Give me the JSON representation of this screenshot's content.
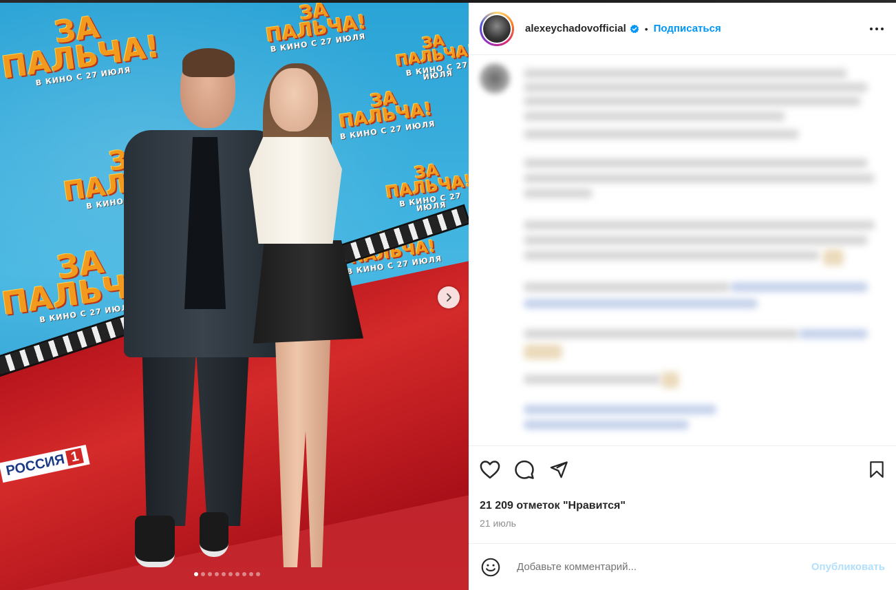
{
  "post": {
    "username": "alexeychadovofficial",
    "separator": "•",
    "follow_label": "Подписаться",
    "likes_text": "21 209 отметок \"Нравится\"",
    "date_text": "21 июль",
    "comment_placeholder": "Добавьте комментарий...",
    "publish_label": "Опубликовать"
  },
  "media": {
    "poster_title_line1": "ЗА",
    "poster_title_line2": "ПАЛЬЧА!",
    "poster_tagline": "В КИНО С 27 ИЮЛЯ",
    "sponsor_text": "РОССИЯ",
    "sponsor_number": "1",
    "carousel_count": 10,
    "carousel_active_index": 0
  },
  "icons": {
    "verified": "verified-badge-icon",
    "more": "more-horizontal-icon",
    "like": "heart-icon",
    "comment": "comment-bubble-icon",
    "share": "paper-plane-icon",
    "save": "bookmark-icon",
    "emoji": "smiley-icon",
    "next": "chevron-right-icon"
  },
  "colors": {
    "accent": "#0095f6",
    "publish_disabled": "#b2dffc",
    "text": "#262626",
    "muted": "#8e8e8e"
  }
}
